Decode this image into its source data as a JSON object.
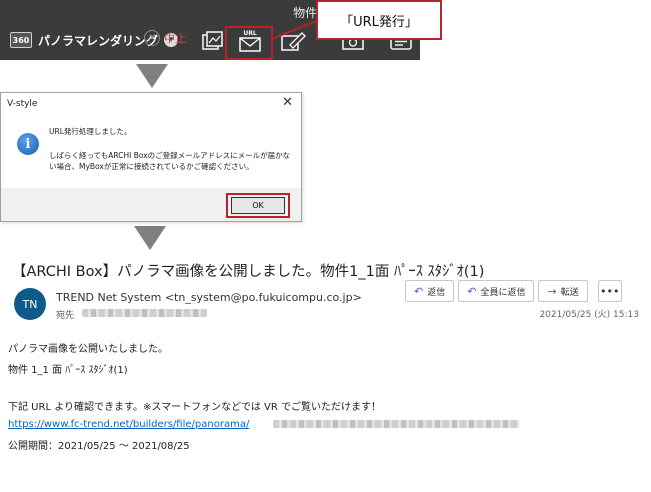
{
  "toolbar": {
    "title": "物件1_1面 ﾊﾟｰｽ ｽﾀｼﾞｵ",
    "panorama_badge": "360",
    "panorama_label": "パノラマレンダリング",
    "cancel_label": "中止",
    "url_icon_label": "URL"
  },
  "callout": {
    "text": "「URL発行」"
  },
  "dialog": {
    "title": "V-style",
    "message_line1": "URL発行処理しました。",
    "message_line2": "しばらく経ってもARCHI Boxのご登録メールアドレスにメールが届かない場合、MyBoxが正常に接続されているかご確認ください。",
    "ok_label": "OK"
  },
  "email": {
    "subject": "【ARCHI Box】パノラマ画像を公開しました。物件1_1面 ﾊﾟｰｽ ｽﾀｼﾞｵ(1)",
    "avatar_initials": "TN",
    "sender": "TREND Net System <tn_system@po.fukuicompu.co.jp>",
    "to_label": "宛先",
    "actions": {
      "reply": "返信",
      "reply_all": "全員に返信",
      "forward": "転送",
      "more": "•••"
    },
    "date": "2021/05/25 (火) 15:13",
    "body": {
      "line1": "パノラマ画像を公開いたしました。",
      "line2": "物件 1_1 面 ﾊﾟｰｽ ｽﾀｼﾞｵ(1)",
      "line3": "下記 URL より確認できます。※スマートフォンなどでは VR でご覧いただけます！",
      "link": "https://www.fc-trend.net/builders/file/panorama/",
      "line5": "公開期間：2021/05/25 ～ 2021/08/25"
    }
  },
  "colors": {
    "highlight": "#b5242a",
    "toolbar_bg": "#3b3b3b",
    "link": "#0563c1",
    "avatar": "#0e5a8a"
  }
}
